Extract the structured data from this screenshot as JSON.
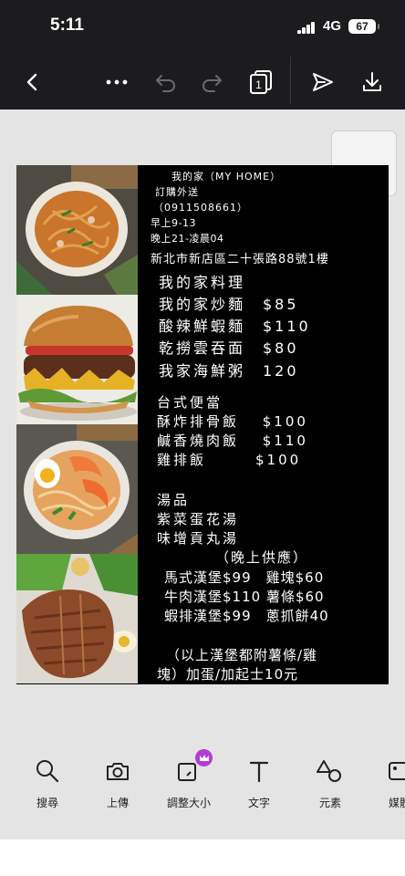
{
  "status": {
    "time": "5:11",
    "network": "4G",
    "battery": "67"
  },
  "toolbar": {
    "page_count": "1",
    "icons": [
      "back-icon",
      "more-icon",
      "undo-icon",
      "redo-icon",
      "pages-icon",
      "send-icon",
      "download-icon"
    ]
  },
  "poster": {
    "photos": [
      "noodles-photo",
      "burger-photo",
      "shrimp-noodle-soup-photo",
      "pork-chop-rice-photo"
    ],
    "lines": [
      "我的家（MY HOME）",
      "訂購外送",
      "（0911508661）",
      "早上9-13",
      "晚上21-凌晨04",
      "新北市新店區二十張路88號1樓",
      "我的家料理",
      "我的家炒麵　$85",
      "酸辣鮮蝦麵　$110",
      "乾撈雲吞面　$80",
      "我家海鮮粥　120",
      "台式便當",
      "酥炸排骨飯　 $100",
      "鹹香燒肉飯　 $110",
      "雞排飯　　　$100",
      "湯品",
      "紫菜蛋花湯",
      "味增貢丸湯",
      "（晚上供應）",
      "馬式漢堡$99　雞塊$60",
      "牛肉漢堡$110 薯條$60",
      "蝦排漢堡$99　蔥抓餅40",
      "（以上漢堡都附薯條/雞",
      "塊）加蛋/加起士10元"
    ]
  },
  "tools": [
    {
      "label": "搜尋",
      "icon": "search-icon"
    },
    {
      "label": "上傳",
      "icon": "camera-icon"
    },
    {
      "label": "調整大小",
      "icon": "resize-icon"
    },
    {
      "label": "文字",
      "icon": "text-icon"
    },
    {
      "label": "元素",
      "icon": "elements-icon"
    },
    {
      "label": "媒體",
      "icon": "media-icon"
    }
  ],
  "colors": {
    "dark_bar": "#1c1c1e",
    "canvas": "#e4e4e4",
    "poster_bg": "#000000",
    "premium_badge": "#b43bd6"
  }
}
